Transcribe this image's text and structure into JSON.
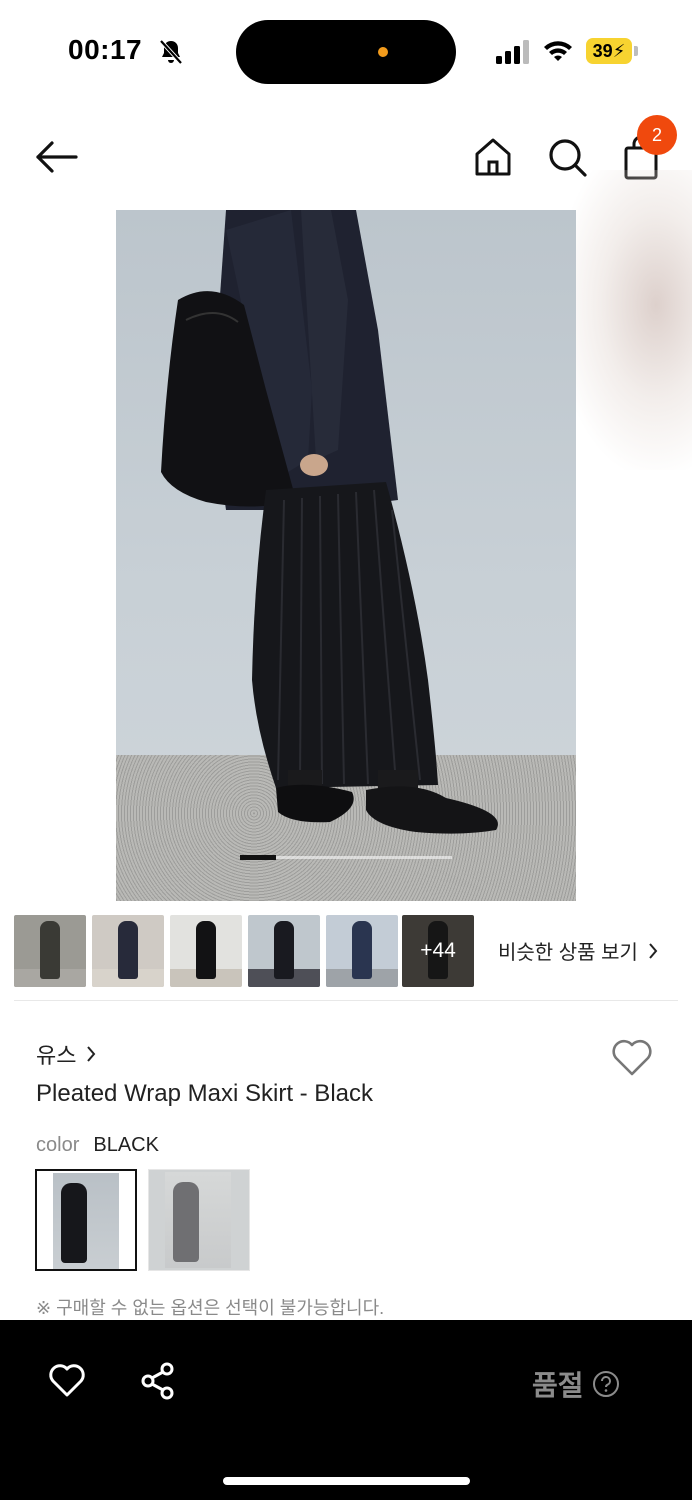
{
  "status_bar": {
    "time": "00:17",
    "battery": "39"
  },
  "header": {
    "cart_count": "2"
  },
  "gallery": {
    "more_count": "+44",
    "similar_label": "비슷한 상품 보기"
  },
  "product": {
    "brand": "유스",
    "name": "Pleated Wrap Maxi Skirt - Black",
    "color_key": "color",
    "color_value": "BLACK",
    "notice": "※ 구매할 수 없는 옵션은 선택이 불가능합니다."
  },
  "bottom_bar": {
    "status_label": "품절"
  },
  "colors": {
    "accent": "#f0490d",
    "battery": "#f7d330",
    "bar_bg": "#000000"
  },
  "icons": [
    "bell-slash-icon",
    "signal-icon",
    "wifi-icon",
    "back-arrow-icon",
    "home-icon",
    "search-icon",
    "shopping-bag-icon",
    "heart-icon",
    "share-icon",
    "help-circle-icon",
    "chevron-right-icon"
  ]
}
